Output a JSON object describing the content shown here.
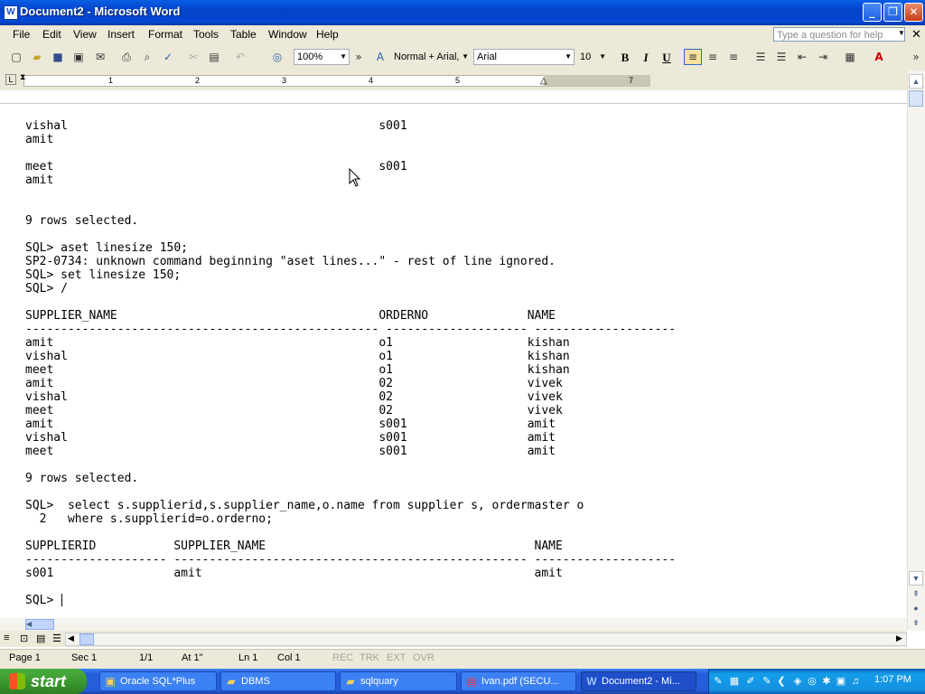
{
  "window": {
    "app_icon": "W",
    "title": "Document2 - Microsoft Word",
    "controls": {
      "minimize": "_",
      "maximize": "❐",
      "close": "✕"
    }
  },
  "menu": {
    "items": [
      "File",
      "Edit",
      "View",
      "Insert",
      "Format",
      "Tools",
      "Table",
      "Window",
      "Help"
    ],
    "help_placeholder": "Type a question for help",
    "doc_close": "✕"
  },
  "toolbar": {
    "zoom": "100%",
    "style": "Normal + Arial,",
    "font": "Arial",
    "size": "10",
    "bold": "B",
    "italic": "I",
    "underline": "U"
  },
  "ruler": {
    "numbers": [
      "1",
      "2",
      "3",
      "4",
      "5",
      "7"
    ],
    "tab_selector": "L"
  },
  "document": {
    "lines": [
      "vishal                                            s001",
      "amit",
      "",
      "meet                                              s001",
      "amit",
      "",
      "",
      "9 rows selected.",
      "",
      "SQL> aset linesize 150;",
      "SP2-0734: unknown command beginning \"aset lines...\" - rest of line ignored.",
      "SQL> set linesize 150;",
      "SQL> /",
      "",
      "SUPPLIER_NAME                                     ORDERNO              NAME",
      "-------------------------------------------------- -------------------- --------------------",
      "amit                                              o1                   kishan",
      "vishal                                            o1                   kishan",
      "meet                                              o1                   kishan",
      "amit                                              02                   vivek",
      "vishal                                            02                   vivek",
      "meet                                              02                   vivek",
      "amit                                              s001                 amit",
      "vishal                                            s001                 amit",
      "meet                                              s001                 amit",
      "",
      "9 rows selected.",
      "",
      "SQL>  select s.supplierid,s.supplier_name,o.name from supplier s, ordermaster o",
      "  2   where s.supplierid=o.orderno;",
      "",
      "SUPPLIERID           SUPPLIER_NAME                                      NAME",
      "-------------------- -------------------------------------------------- --------------------",
      "s001                 amit                                               amit",
      "",
      "SQL> "
    ]
  },
  "status": {
    "page": "Page 1",
    "sec": "Sec 1",
    "pages": "1/1",
    "at": "At 1\"",
    "ln": "Ln 1",
    "col": "Col 1",
    "rec": "REC",
    "trk": "TRK",
    "ext": "EXT",
    "ovr": "OVR"
  },
  "taskbar": {
    "start": "start",
    "tasks": [
      {
        "label": "Oracle SQL*Plus",
        "icon": "sqlplus-icon",
        "active": false
      },
      {
        "label": "DBMS",
        "icon": "folder-icon",
        "active": false
      },
      {
        "label": "sqlquary",
        "icon": "folder-icon",
        "active": false
      },
      {
        "label": "Ivan.pdf (SECU...",
        "icon": "pdf-icon",
        "active": false
      },
      {
        "label": "Document2 - Mi...",
        "icon": "word-icon",
        "active": true
      }
    ],
    "clock": "1:07 PM"
  }
}
